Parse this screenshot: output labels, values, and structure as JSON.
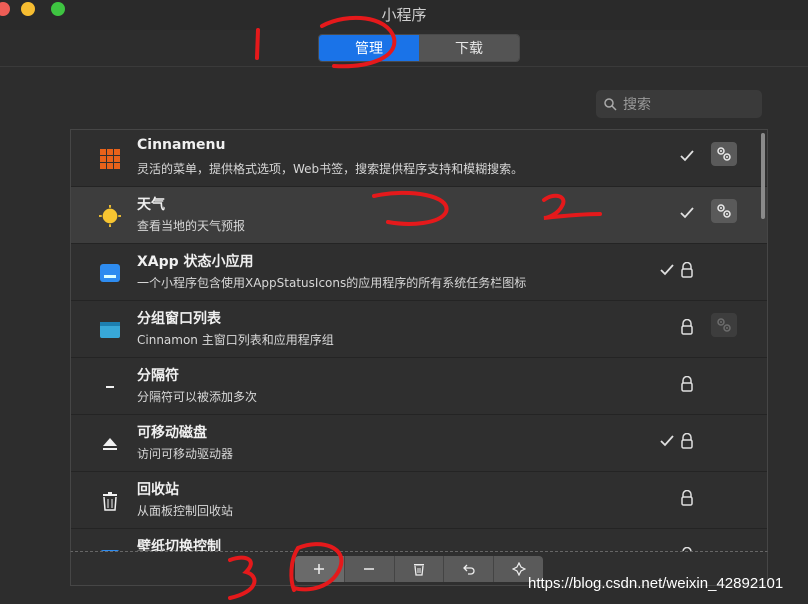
{
  "window": {
    "title": "小程序"
  },
  "tabs": {
    "manage": "管理",
    "download": "下载"
  },
  "search": {
    "placeholder": "搜索"
  },
  "applets": [
    {
      "title": "Cinnamenu",
      "desc": "灵活的菜单，提供格式选项，Web书签，搜索提供程序支持和模糊搜索。",
      "icon": "grid-menu-icon",
      "enabled": true,
      "locked": false,
      "configurable": true
    },
    {
      "title": "天气",
      "desc": "查看当地的天气预报",
      "icon": "sun-icon",
      "enabled": true,
      "locked": false,
      "configurable": true,
      "selected": true
    },
    {
      "title": "XApp 状态小应用",
      "desc": "一个小程序包含使用XAppStatusIcons的应用程序的所有系统任务栏图标",
      "icon": "xapp-status-icon",
      "enabled": true,
      "locked": true,
      "configurable": false
    },
    {
      "title": "分组窗口列表",
      "desc": "Cinnamon 主窗口列表和应用程序组",
      "icon": "window-list-icon",
      "enabled": false,
      "locked": true,
      "configurable": true,
      "config_disabled": true
    },
    {
      "title": "分隔符",
      "desc": "分隔符可以被添加多次",
      "icon": "separator-icon",
      "enabled": false,
      "locked": true,
      "configurable": false
    },
    {
      "title": "可移动磁盘",
      "desc": "访问可移动驱动器",
      "icon": "eject-icon",
      "enabled": true,
      "locked": true,
      "configurable": false
    },
    {
      "title": "回收站",
      "desc": "从面板控制回收站",
      "icon": "trash-icon",
      "enabled": false,
      "locked": true,
      "configurable": false
    },
    {
      "title": "壁纸切换控制",
      "desc": "",
      "icon": "wallpaper-icon",
      "enabled": false,
      "locked": true,
      "configurable": false
    }
  ],
  "toolbar": [
    "add-icon",
    "remove-icon",
    "uninstall-icon",
    "undo-icon",
    "extra-icon"
  ],
  "watermark": "https://blog.csdn.net/weixin_42892101",
  "annotations": [
    "1",
    "2",
    "3"
  ],
  "colors": {
    "accent": "#1a73e8",
    "annotation": "#e5191b"
  }
}
